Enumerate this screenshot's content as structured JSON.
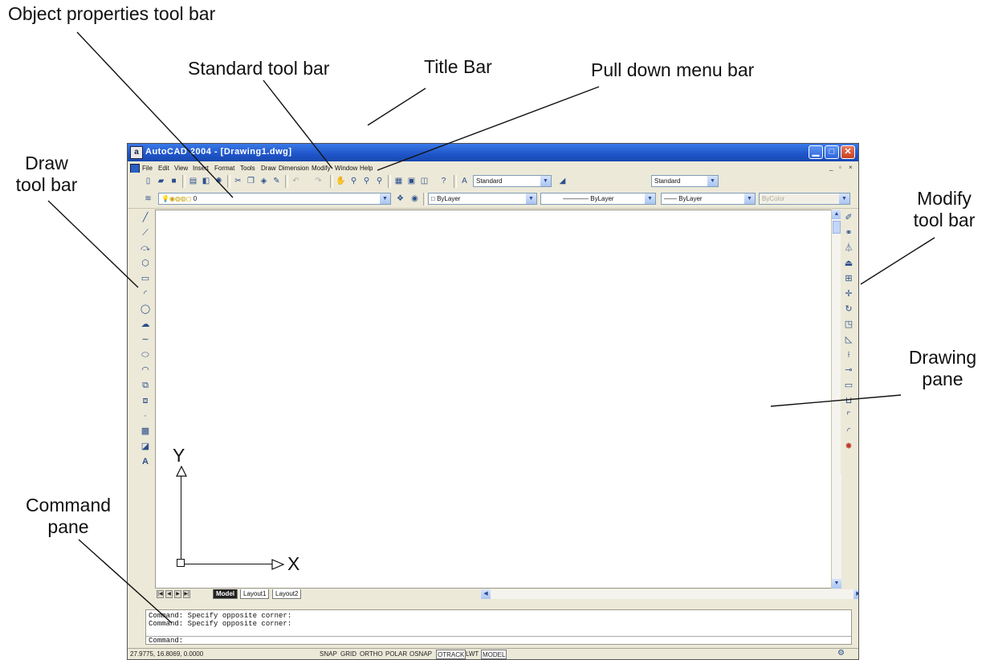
{
  "annotations": {
    "object_properties": "Object properties tool bar",
    "standard": "Standard tool bar",
    "title_bar": "Title Bar",
    "pull_down": "Pull down menu bar",
    "draw_1": "Draw",
    "draw_2": "tool bar",
    "modify_1": "Modify",
    "modify_2": "tool bar",
    "drawing_1": "Drawing",
    "drawing_2": "pane",
    "command_1": "Command",
    "command_2": "pane"
  },
  "window": {
    "title": "AutoCAD 2004 - [Drawing1.dwg]",
    "app_icon": "a"
  },
  "menu": [
    "File",
    "Edit",
    "View",
    "Insert",
    "Format",
    "Tools",
    "Draw",
    "Dimension",
    "Modify",
    "Window",
    "Help"
  ],
  "standard_toolbar": {
    "text_style": "Standard",
    "dim_style": "Standard"
  },
  "properties_toolbar": {
    "layer": "0",
    "color": "ByLayer",
    "linetype": "ByLayer",
    "lineweight": "ByLayer",
    "plot_style": "ByColor"
  },
  "ucs": {
    "x_label": "X",
    "y_label": "Y"
  },
  "layout_tabs": [
    "Model",
    "Layout1",
    "Layout2"
  ],
  "command_lines": [
    "Command: Specify opposite corner:",
    "Command: Specify opposite corner:",
    "Command:"
  ],
  "status": {
    "coords": "27.9775, 16.8069, 0.0000",
    "buttons": [
      "SNAP",
      "GRID",
      "ORTHO",
      "POLAR",
      "OSNAP",
      "OTRACK",
      "LWT",
      "MODEL"
    ]
  },
  "icons": {
    "draw_toolbar": [
      "line-icon",
      "construction-line-icon",
      "polyline-icon",
      "polygon-icon",
      "rectangle-icon",
      "arc-icon",
      "circle-icon",
      "revision-cloud-icon",
      "spline-icon",
      "ellipse-icon",
      "ellipse-arc-icon",
      "insert-block-icon",
      "make-block-icon",
      "point-icon",
      "hatch-icon",
      "region-icon",
      "multiline-text-icon"
    ],
    "modify_toolbar": [
      "erase-icon",
      "copy-icon",
      "mirror-icon",
      "offset-icon",
      "array-icon",
      "move-icon",
      "rotate-icon",
      "scale-icon",
      "stretch-icon",
      "trim-icon",
      "extend-icon",
      "break-icon",
      "join-icon",
      "chamfer-icon",
      "fillet-icon",
      "explode-icon"
    ]
  }
}
